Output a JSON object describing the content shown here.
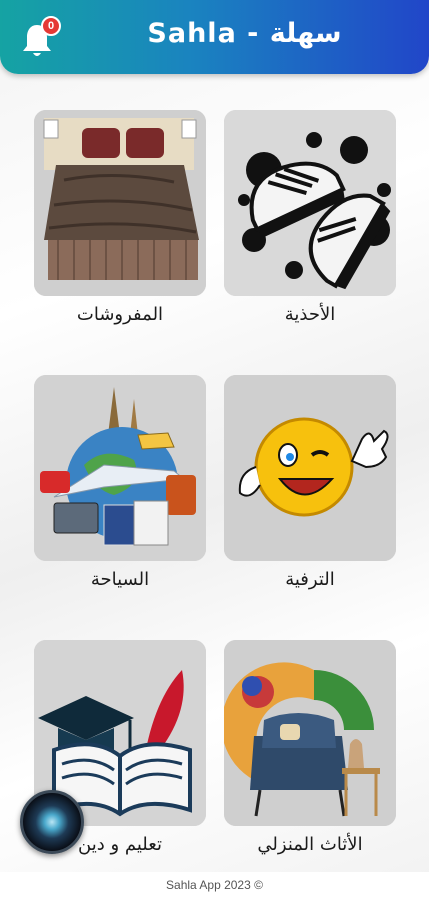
{
  "header": {
    "title": "Sahla - سهلة",
    "notification_count": "0",
    "bell_icon": "bell-icon"
  },
  "categories": [
    {
      "label": "الأحذية",
      "image": "shoes-image"
    },
    {
      "label": "المفروشات",
      "image": "bedding-image"
    },
    {
      "label": "الترفية",
      "image": "entertainment-image"
    },
    {
      "label": "السياحة",
      "image": "tourism-image"
    },
    {
      "label": "الأثاث المنزلي",
      "image": "home-furniture-image"
    },
    {
      "label": "تعليم و دين",
      "image": "education-religion-image"
    }
  ],
  "footer": {
    "text": "Sahla App 2023 ©"
  },
  "colors": {
    "header_start": "#15a3a3",
    "header_end": "#2146c9",
    "badge": "#e53935",
    "card_bg": "#cdcdcd"
  },
  "fab_icon": "camera-lens-icon"
}
